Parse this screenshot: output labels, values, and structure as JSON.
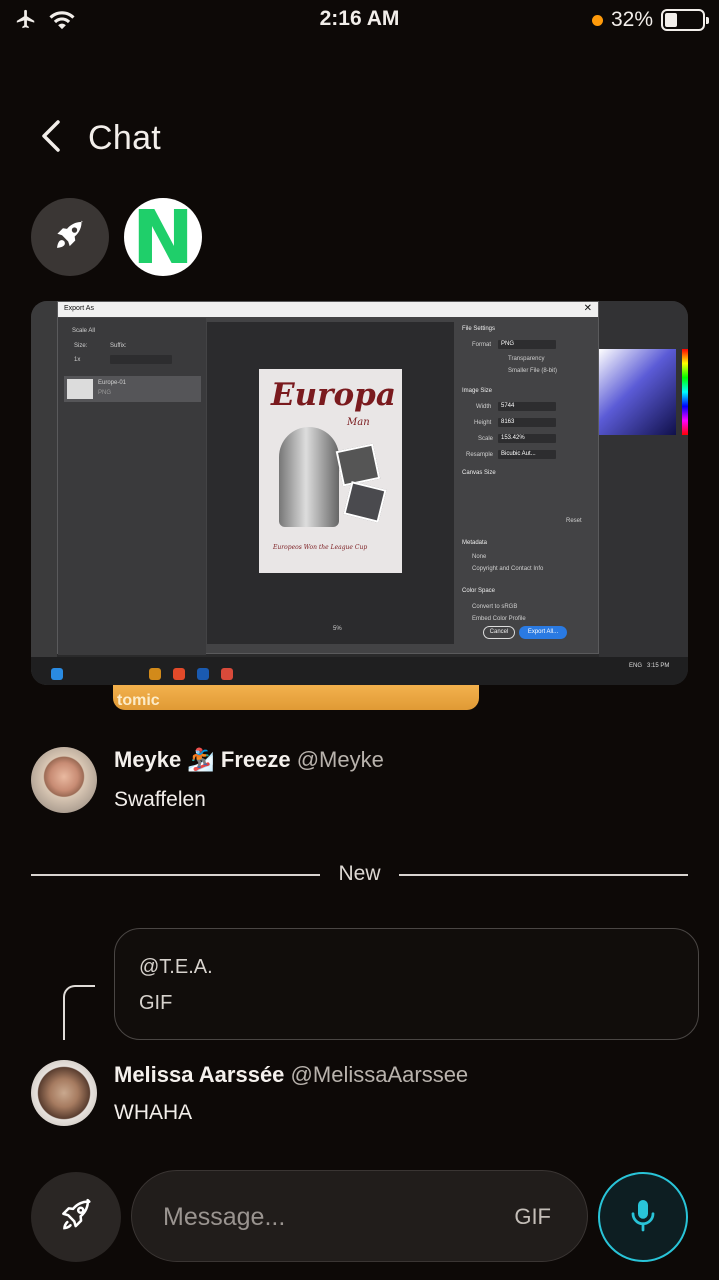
{
  "status_bar": {
    "time": "2:16 AM",
    "battery_percent": "32%",
    "battery_level": 0.32,
    "icons": [
      "airplane-icon",
      "wifi-icon",
      "battery-icon"
    ]
  },
  "header": {
    "back_icon": "chevron-left-icon",
    "title": "Chat"
  },
  "channels": [
    {
      "icon": "rocket-icon"
    },
    {
      "letter": "N"
    }
  ],
  "attachment": {
    "dialog_title": "Export As",
    "scale_all": "Scale All",
    "size_label": "Size:",
    "suffix_label": "Suffix:",
    "scale_value": "1x",
    "asset_name": "Europe-01",
    "asset_meta": "PNG",
    "file_settings": "File Settings",
    "format_label": "Format",
    "format_value": "PNG",
    "transparency": "Transparency",
    "smaller_file": "Smaller File (8-bit)",
    "image_size": "Image Size",
    "width_label": "Width",
    "width_value": "5744",
    "height_label": "Height",
    "height_value": "8163",
    "scale_label": "Scale",
    "scale_pct": "153.42%",
    "resample_label": "Resample",
    "resample_value": "Bicubic Aut...",
    "canvas_size": "Canvas Size",
    "reset": "Reset",
    "metadata": "Metadata",
    "meta_none": "None",
    "meta_copyright": "Copyright and Contact Info",
    "color_space": "Color Space",
    "convert_srgb": "Convert to sRGB",
    "embed_profile": "Embed Color Profile",
    "cancel": "Cancel",
    "export_all": "Export All...",
    "zoom": "5%",
    "poster_title": "Europa",
    "poster_subtitle": "Man",
    "poster_footer": "Europeos Won the League Cup",
    "taskbar_time": "3:15 PM",
    "taskbar_lang": "ENG",
    "food_caption": "tomic"
  },
  "messages": [
    {
      "name": "Meyke 🏂 Freeze",
      "handle": "@Meyke",
      "text": "Swaffelen"
    },
    {
      "reply_to": "@T.E.A.",
      "reply_text": "GIF",
      "name": "Melissa Aarssée",
      "handle": "@MelissaAarssee",
      "text": "WHAHA"
    }
  ],
  "divider_label": "New",
  "composer": {
    "placeholder": "Message...",
    "gif_label": "GIF"
  },
  "colors": {
    "background": "#0d0907",
    "accent_mic": "#29c4d8",
    "battery_dot": "#ff9a0a",
    "n_logo": "#1fcf6a"
  }
}
